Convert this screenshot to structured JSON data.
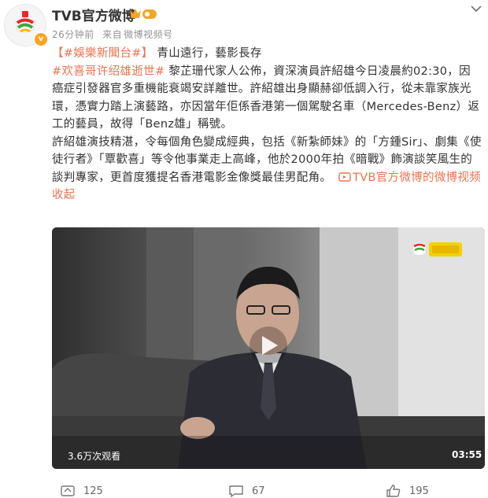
{
  "header": {
    "username": "TVB官方微博",
    "time": "26分钟前",
    "source_prefix": "来自",
    "source": "微博视频号"
  },
  "post": {
    "line1_tag": "【#娛樂新聞台#】",
    "line1_text": "青山遠行，藝影長存",
    "para1_tag": "#欢喜哥许绍雄逝世#",
    "para1_text": " 黎芷珊代家人公佈，資深演員許紹雄今日凌晨約02:30，因癌症引發器官多重機能衰竭安詳離世。許紹雄出身顯赫卻低調入行，從未靠家族光環，憑實力踏上演藝路，亦因當年佢係香港第一個駕駛名車（Mercedes-Benz）返工的藝員，故得「Benz雄」稱號。",
    "para2_text": "許紹雄演技精湛，令每個角色變成經典，包括《新紮師妹》的「方鍾Sir」、劇集《使徒行者》「覃歡喜」等令他事業走上高峰，他於2000年拍《暗戰》飾演談笑風生的談判專家，更首度獲提名香港電影金像獎最佳男配角。",
    "video_link": "TVB官方微博的微博视频",
    "collapse": "收起"
  },
  "video": {
    "views": "3.6万次观看",
    "duration": "03:55"
  },
  "actions": {
    "repost": "125",
    "comment": "67",
    "like": "195"
  },
  "colors": {
    "accent": "#eb7350",
    "muted": "#939393",
    "text": "#333333"
  },
  "icons": {
    "more": "chevron-down-icon",
    "verified": "verified-badge-icon",
    "repost": "repost-icon",
    "comment": "comment-icon",
    "like": "thumbs-up-icon",
    "play": "play-icon"
  }
}
